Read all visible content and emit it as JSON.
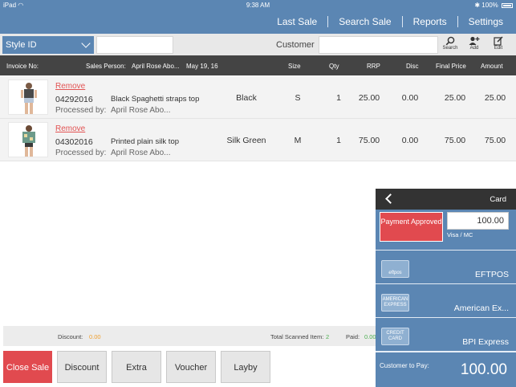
{
  "status_bar": {
    "device": "iPad",
    "time": "9:38 AM",
    "battery": "100%"
  },
  "nav": [
    "Last Sale",
    "Search Sale",
    "Reports",
    "Settings"
  ],
  "search": {
    "field_select": "Style ID",
    "field_value": "",
    "customer_label": "Customer",
    "customer_value": "",
    "actions": [
      "Search",
      "Add",
      "Edit"
    ]
  },
  "table": {
    "header": {
      "invoice": "Invoice No:",
      "sales_person_label": "Sales Person:",
      "sales_person": "April Rose Abo...",
      "date": "May 19, 16",
      "size": "Size",
      "qty": "Qty",
      "rrp": "RRP",
      "disc": "Disc",
      "final_price": "Final Price",
      "amount": "Amount"
    },
    "rows": [
      {
        "remove": "Remove",
        "invoice": "04292016",
        "processed_label": "Processed by:",
        "processed_by": "April Rose Abo...",
        "description": "Black Spaghetti straps top",
        "color": "Black",
        "size": "S",
        "qty": "1",
        "rrp": "25.00",
        "disc": "0.00",
        "final_price": "25.00",
        "amount": "25.00"
      },
      {
        "remove": "Remove",
        "invoice": "04302016",
        "processed_label": "Processed by:",
        "processed_by": "April Rose Abo...",
        "description": "Printed plain silk top",
        "color": "Silk Green",
        "size": "M",
        "qty": "1",
        "rrp": "75.00",
        "disc": "0.00",
        "final_price": "75.00",
        "amount": "75.00"
      }
    ]
  },
  "summary": {
    "discount_label": "Discount:",
    "discount_value": "0.00",
    "scanned_label": "Total Scanned Item:",
    "scanned_value": "2",
    "paid_label": "Paid:",
    "paid_value": "0.00"
  },
  "buttons": [
    "Close Sale",
    "Discount",
    "Extra",
    "Voucher",
    "Layby"
  ],
  "payment": {
    "title": "Card",
    "approved_label": "Payment Approved",
    "amount": "100.00",
    "card_type": "Visa / MC",
    "methods": [
      {
        "name": "EFTPOS",
        "logo": "eftpos"
      },
      {
        "name": "American Ex...",
        "logo": "AMERICAN EXPRESS"
      },
      {
        "name": "BPI Express",
        "logo": "CREDIT CARD"
      }
    ],
    "to_pay_label": "Customer to Pay:",
    "to_pay_value": "100.00"
  },
  "colors": {
    "primary": "#5b86b3",
    "header_dark": "#444444",
    "danger": "#e14a4f",
    "success": "#4caf50"
  }
}
